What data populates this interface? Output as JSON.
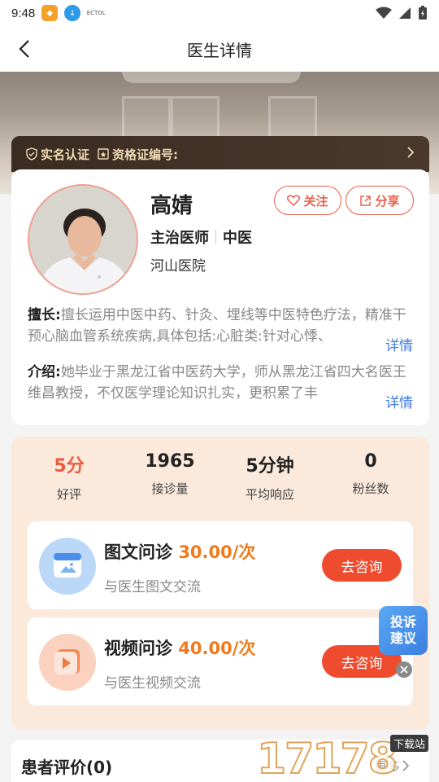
{
  "status_bar": {
    "time": "9:48",
    "app3_text": "ECTOL"
  },
  "nav": {
    "title": "医生详情"
  },
  "cert": {
    "realname": "实名认证",
    "license": "资格证编号:"
  },
  "doctor": {
    "name": "高婧",
    "follow_label": "关注",
    "share_label": "分享",
    "title": "主治医师",
    "department": "中医",
    "hospital": "河山医院",
    "skill_label": "擅长:",
    "skill_text": "擅长运用中医中药、针灸、埋线等中医特色疗法，精准干预心脑血管系统疾病,具体包括:心脏类:针对心悸、",
    "intro_label": "介绍:",
    "intro_text": "她毕业于黑龙江省中医药大学，师从黑龙江省四大名医王维昌教授，不仅医学理论知识扎实，更积累了丰",
    "more_label": "详情"
  },
  "stats": [
    {
      "value": "5分",
      "label": "好评",
      "highlight": true
    },
    {
      "value": "1965",
      "label": "接诊量",
      "highlight": false
    },
    {
      "value": "5分钟",
      "label": "平均响应",
      "highlight": false
    },
    {
      "value": "0",
      "label": "粉丝数",
      "highlight": false
    }
  ],
  "consult": [
    {
      "name": "图文问诊",
      "price": "30.00/次",
      "desc": "与医生图文交流",
      "button": "去咨询",
      "icon": "image-chat-icon"
    },
    {
      "name": "视频问诊",
      "price": "40.00/次",
      "desc": "与医生视频交流",
      "button": "去咨询",
      "icon": "video-chat-icon"
    }
  ],
  "float": {
    "line1": "投诉",
    "line2": "建议"
  },
  "reviews": {
    "title": "患者评价(0)",
    "more": "更多"
  },
  "watermark": {
    "digits": "17178",
    "tag": "下载站"
  },
  "colors": {
    "accent": "#ee4b2f",
    "price": "#f07a1a",
    "link": "#3d7be0",
    "gold": "#f0d9b4"
  }
}
